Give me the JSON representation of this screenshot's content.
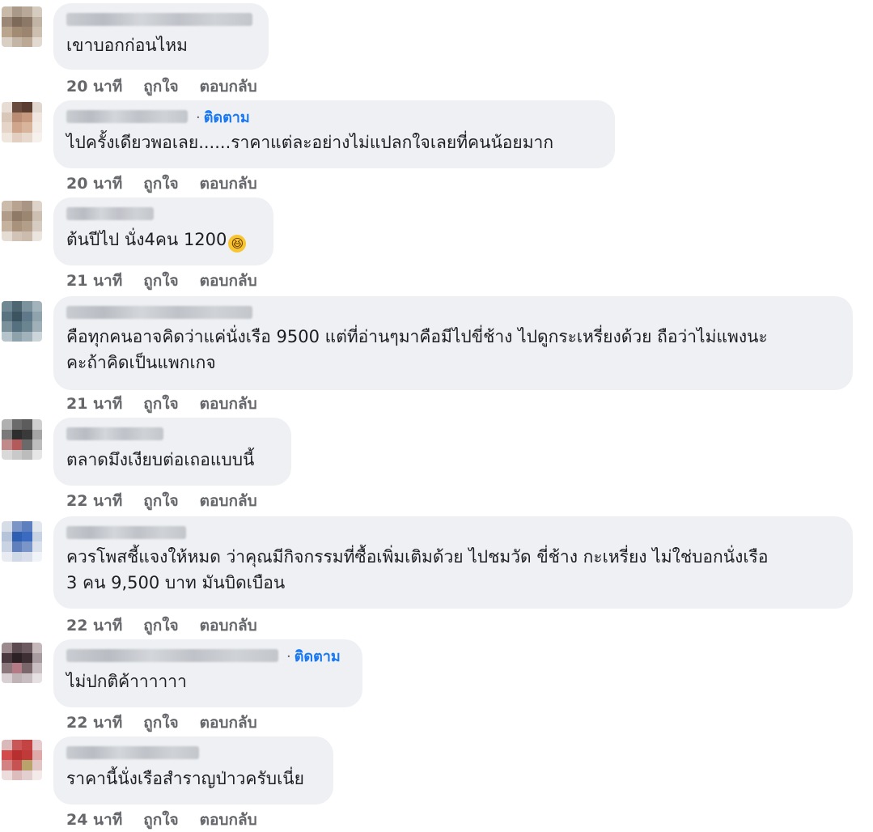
{
  "comments": [
    {
      "text": "เขาบอกก่อนไหม",
      "time": "20 นาที",
      "follow": ""
    },
    {
      "text": "ไปครั้งเดียวพอเลย......ราคาแต่ละอย่างไม่แปลกใจเลยที่คนน้อยมาก",
      "time": "20 นาที",
      "follow": "ติดตาม"
    },
    {
      "text": "ต้นปีไป นั่ง4คน 1200",
      "time": "21 นาที",
      "follow": "",
      "emoji": "😆"
    },
    {
      "text_line1": "คือทุกคนอาจคิดว่าแค่นั่งเรือ 9500 แต่ที่อ่านๆมาคือมีไปขี่ช้าง ไปดูกระเหรี่ยงด้วย ถือว่าไม่แพงนะ",
      "text_line2": "คะถ้าคิดเป็นแพกเกจ",
      "time": "21 นาที",
      "follow": ""
    },
    {
      "text": "ตลาดมึงเงียบต่อเถอแบบนี้",
      "time": "22 นาที",
      "follow": ""
    },
    {
      "text_line1": "ควรโพสชี้แจงให้หมด ว่าคุณมีกิจกรรมที่ซื้อเพิ่มเติมด้วย ไปชมวัด ขี่ช้าง กะเหรี่ยง ไม่ใช่บอกนั่งเรือ",
      "text_line2": "3 คน 9,500 บาท มันบิดเบือน",
      "time": "22 นาที",
      "follow": ""
    },
    {
      "text": "ไม่ปกติค้าาาาาา",
      "time": "22 นาที",
      "follow": "ติดตาม"
    },
    {
      "text": "ราคานี้นั่งเรือสำราญป่าวครับเนี่ย",
      "time": "24 นาที",
      "follow": ""
    }
  ],
  "labels": {
    "like": "ถูกใจ",
    "reply": "ตอบกลับ"
  },
  "colors": {
    "bubble": "#eef0f3",
    "follow": "#1877f2",
    "meta": "#65676b"
  }
}
